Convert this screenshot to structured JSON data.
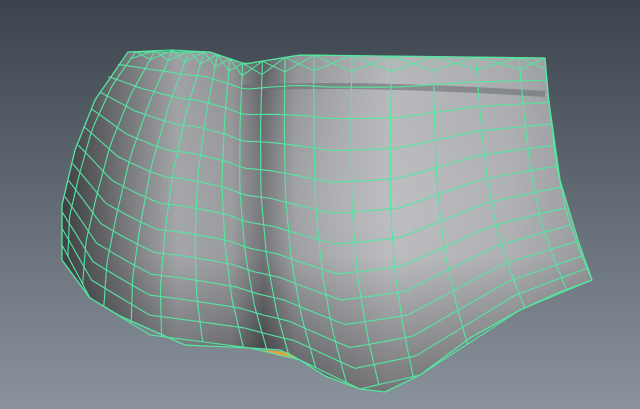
{
  "viewport": {
    "background_top": "#3b434c",
    "background_bottom": "#8a939c"
  },
  "model": {
    "shading_light": "#b8b9bc",
    "shading_mid": "#9a9ca0",
    "shading_dark": "#3f4043",
    "wireframe_color": "#55e6a0",
    "selected_highlight": "#e6a040",
    "wireframe_rows": 12,
    "wireframe_columns": 16
  }
}
